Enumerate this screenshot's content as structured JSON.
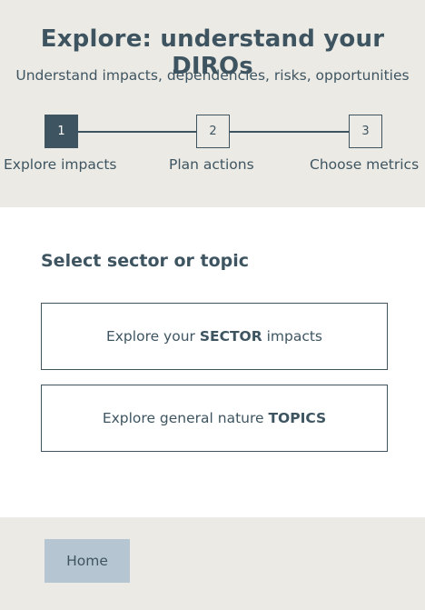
{
  "header": {
    "title": "Explore: understand your DIROs",
    "subtitle": "Understand impacts, dependencies, risks, opportunities"
  },
  "stepper": {
    "steps": [
      {
        "number": "1",
        "label": "Explore impacts",
        "active": true
      },
      {
        "number": "2",
        "label": "Plan actions",
        "active": false
      },
      {
        "number": "3",
        "label": "Choose metrics",
        "active": false
      }
    ]
  },
  "main": {
    "section_title": "Select sector or topic",
    "options": [
      {
        "prefix": "Explore your ",
        "emphasis": "SECTOR",
        "suffix": " impacts"
      },
      {
        "prefix": "Explore general nature ",
        "emphasis": "TOPICS",
        "suffix": ""
      }
    ]
  },
  "footer": {
    "home_label": "Home"
  },
  "colors": {
    "primary": "#3e5561",
    "background": "#eceae5",
    "panel": "#ffffff",
    "button": "#b6c5d2"
  }
}
